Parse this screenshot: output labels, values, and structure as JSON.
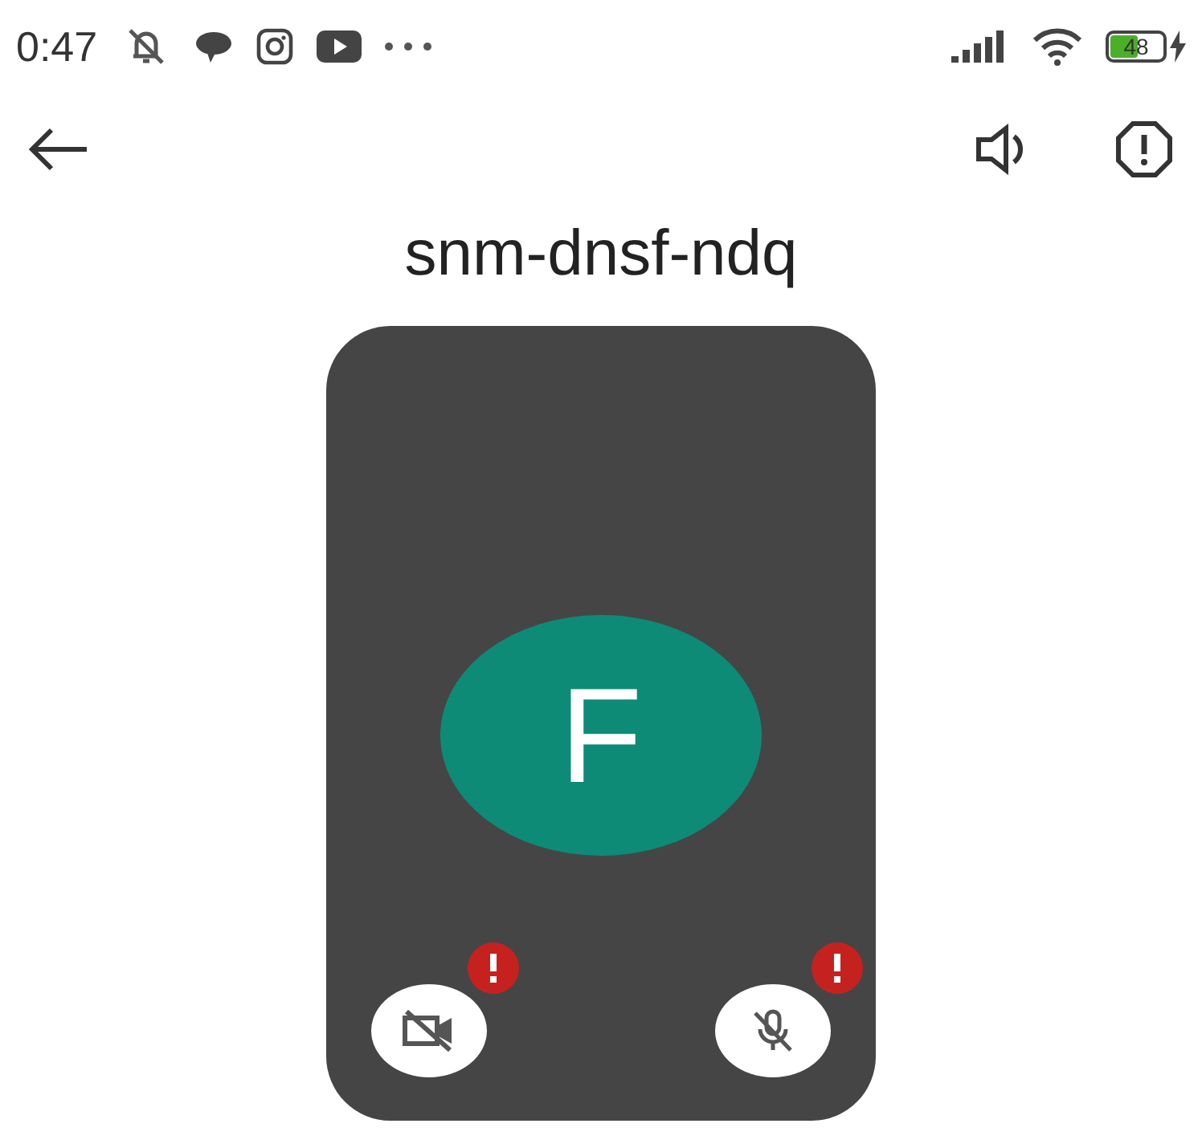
{
  "status_bar": {
    "time": "0:47",
    "battery": "48"
  },
  "meeting_code": "snm-dnsf-ndq",
  "participant": {
    "initial": "F"
  },
  "controls": [
    {
      "kind": "camera",
      "on": false,
      "warning": true
    },
    {
      "kind": "microphone",
      "on": false,
      "warning": true
    }
  ]
}
